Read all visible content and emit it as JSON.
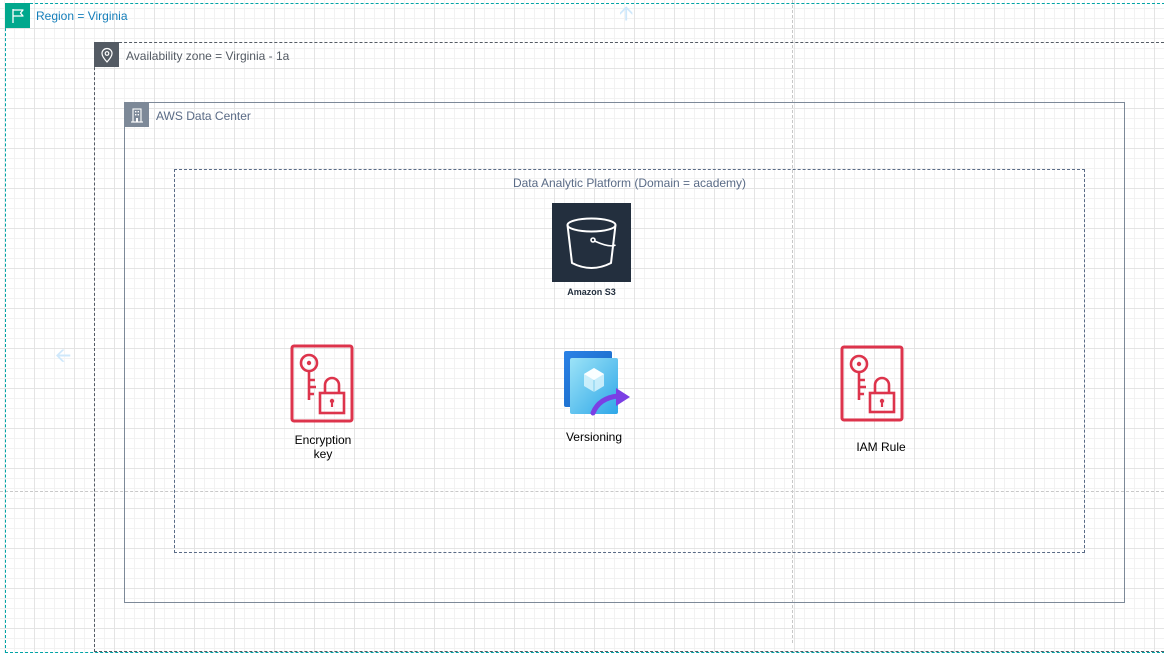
{
  "region": {
    "label": "Region = Virginia",
    "icon": "flag-icon"
  },
  "availability_zone": {
    "label": "Availability zone = Virginia - 1a",
    "icon": "location-pin-icon"
  },
  "data_center": {
    "label": "AWS Data Center",
    "icon": "corporate-building-icon"
  },
  "platform": {
    "label": "Data Analytic Platform (Domain = academy)"
  },
  "nodes": {
    "s3": {
      "label": "Amazon S3",
      "icon": "s3-bucket-icon"
    },
    "encryption_key": {
      "line1": "Encryption",
      "line2": "key",
      "icon": "key-lock-icon"
    },
    "versioning": {
      "label": "Versioning",
      "icon": "versioning-icon"
    },
    "iam_rule": {
      "label": "IAM Rule",
      "icon": "key-lock-icon"
    }
  },
  "colors": {
    "region_border": "#00a4a6",
    "region_icon_bg": "#01a88d",
    "region_text": "#147eba",
    "az_border": "#545b64",
    "dc_border": "#7d8998",
    "s3_tile": "#232f3e",
    "security_red": "#dd344c",
    "versioning_blue": "#1e90e0",
    "versioning_arrow": "#7b3fe4"
  }
}
